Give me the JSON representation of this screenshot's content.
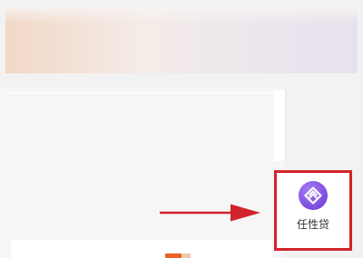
{
  "app_entry": {
    "label": "任性贷",
    "icon": "diamond-logo-icon",
    "icon_color": "#7b4be0"
  },
  "annotation": {
    "highlight_color": "#d2232a",
    "arrow_color": "#d2232a"
  },
  "accent": {
    "tab_indicator_color": "#e8622a"
  }
}
